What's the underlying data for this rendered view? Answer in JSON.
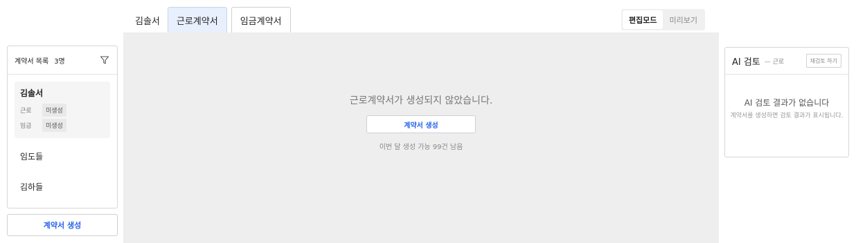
{
  "tabs": [
    {
      "label": "김솔서"
    },
    {
      "label": "근로계약서"
    },
    {
      "label": "임금계약서"
    }
  ],
  "mode": {
    "edit_label": "편집모드",
    "preview_label": "미리보기"
  },
  "contract_list": {
    "title": "계약서 목록",
    "count": "3명",
    "people": [
      {
        "name": "김솔서",
        "statuses": [
          {
            "label": "근로",
            "badge": "미생성"
          },
          {
            "label": "임금",
            "badge": "미생성"
          }
        ]
      },
      {
        "name": "임도들"
      },
      {
        "name": "김하들"
      }
    ],
    "create_label": "계약서 생성"
  },
  "main": {
    "empty_message": "근로계약서가 생성되지 않았습니다.",
    "create_label": "계약서 생성",
    "quota_text": "이번 달 생성 가능 99건 남음"
  },
  "ai_review": {
    "title": "AI 검토",
    "subtitle": "— 근로",
    "rereview_label": "재검토 하기",
    "empty_title": "AI 검토 결과가 없습니다",
    "empty_desc": "계약서를 생성하면 검토 결과가 표시됩니다."
  },
  "colors": {
    "accent": "#2563eb",
    "active_tab_bg": "#e8f0fe",
    "main_bg": "#eeeeee"
  },
  "icons": {
    "filter": "filter-icon"
  }
}
